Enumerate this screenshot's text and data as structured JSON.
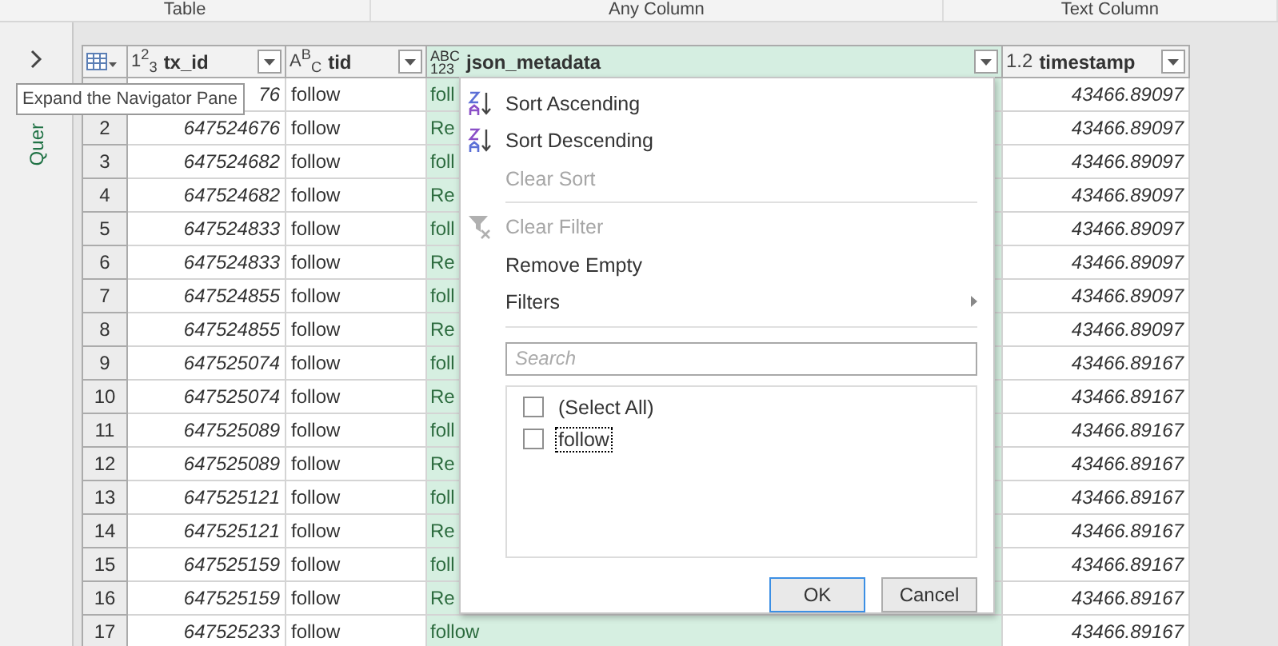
{
  "ribbon_groups": [
    "Table",
    "Any Column",
    "Text Column"
  ],
  "navigator": {
    "label": "Quer",
    "tooltip": "Expand the Navigator Pane"
  },
  "table": {
    "columns": [
      {
        "kind": "int",
        "type_label": [
          "1$^{2}$$_{3}$"
        ],
        "name": "tx_id"
      },
      {
        "kind": "text",
        "type_label": [
          "A$^{B}$$_{C}$"
        ],
        "name": "tid"
      },
      {
        "kind": "any",
        "type_label": [
          "ABC",
          "123"
        ],
        "name": "json_metadata",
        "selected": true
      },
      {
        "kind": "decimal",
        "type_label": [
          "1.2"
        ],
        "name": "timestamp",
        "selected": false
      }
    ],
    "rows": [
      {
        "index": null,
        "tx_id": "76",
        "tid": "follow",
        "json": "foll",
        "timestamp": "43466.89097"
      },
      {
        "index": "2",
        "tx_id": "647524676",
        "tid": "follow",
        "json": "Re",
        "timestamp": "43466.89097"
      },
      {
        "index": "3",
        "tx_id": "647524682",
        "tid": "follow",
        "json": "foll",
        "timestamp": "43466.89097"
      },
      {
        "index": "4",
        "tx_id": "647524682",
        "tid": "follow",
        "json": "Re",
        "timestamp": "43466.89097"
      },
      {
        "index": "5",
        "tx_id": "647524833",
        "tid": "follow",
        "json": "foll",
        "timestamp": "43466.89097"
      },
      {
        "index": "6",
        "tx_id": "647524833",
        "tid": "follow",
        "json": "Re",
        "timestamp": "43466.89097"
      },
      {
        "index": "7",
        "tx_id": "647524855",
        "tid": "follow",
        "json": "foll",
        "timestamp": "43466.89097"
      },
      {
        "index": "8",
        "tx_id": "647524855",
        "tid": "follow",
        "json": "Re",
        "timestamp": "43466.89097"
      },
      {
        "index": "9",
        "tx_id": "647525074",
        "tid": "follow",
        "json": "foll",
        "timestamp": "43466.89167"
      },
      {
        "index": "10",
        "tx_id": "647525074",
        "tid": "follow",
        "json": "Re",
        "timestamp": "43466.89167"
      },
      {
        "index": "11",
        "tx_id": "647525089",
        "tid": "follow",
        "json": "foll",
        "timestamp": "43466.89167"
      },
      {
        "index": "12",
        "tx_id": "647525089",
        "tid": "follow",
        "json": "Re",
        "timestamp": "43466.89167"
      },
      {
        "index": "13",
        "tx_id": "647525121",
        "tid": "follow",
        "json": "foll",
        "timestamp": "43466.89167"
      },
      {
        "index": "14",
        "tx_id": "647525121",
        "tid": "follow",
        "json": "Re",
        "timestamp": "43466.89167"
      },
      {
        "index": "15",
        "tx_id": "647525159",
        "tid": "follow",
        "json": "foll",
        "timestamp": "43466.89167"
      },
      {
        "index": "16",
        "tx_id": "647525159",
        "tid": "follow",
        "json": "Re",
        "timestamp": "43466.89167"
      },
      {
        "index": "17",
        "tx_id": "647525233",
        "tid": "follow",
        "json": "follow",
        "timestamp": "43466.89167"
      }
    ]
  },
  "filter_menu": {
    "items": [
      {
        "kind": "sort_asc",
        "label": "Sort Ascending",
        "disabled": false
      },
      {
        "kind": "sort_desc",
        "label": "Sort Descending",
        "disabled": false
      },
      {
        "kind": "plain",
        "label": "Clear Sort",
        "disabled": true
      },
      {
        "kind": "divider"
      },
      {
        "kind": "clear_filter",
        "label": "Clear Filter",
        "disabled": true
      },
      {
        "kind": "plain",
        "label": "Remove Empty",
        "disabled": false
      },
      {
        "kind": "submenu",
        "label": "Filters",
        "disabled": false
      },
      {
        "kind": "divider"
      }
    ],
    "search": {
      "placeholder": "Search"
    },
    "values": [
      {
        "label": "(Select All)",
        "checked": false,
        "focused": false
      },
      {
        "label": "follow",
        "checked": false,
        "focused": true
      }
    ],
    "buttons": [
      {
        "label": "OK",
        "default": true
      },
      {
        "label": "Cancel",
        "default": false
      }
    ]
  }
}
